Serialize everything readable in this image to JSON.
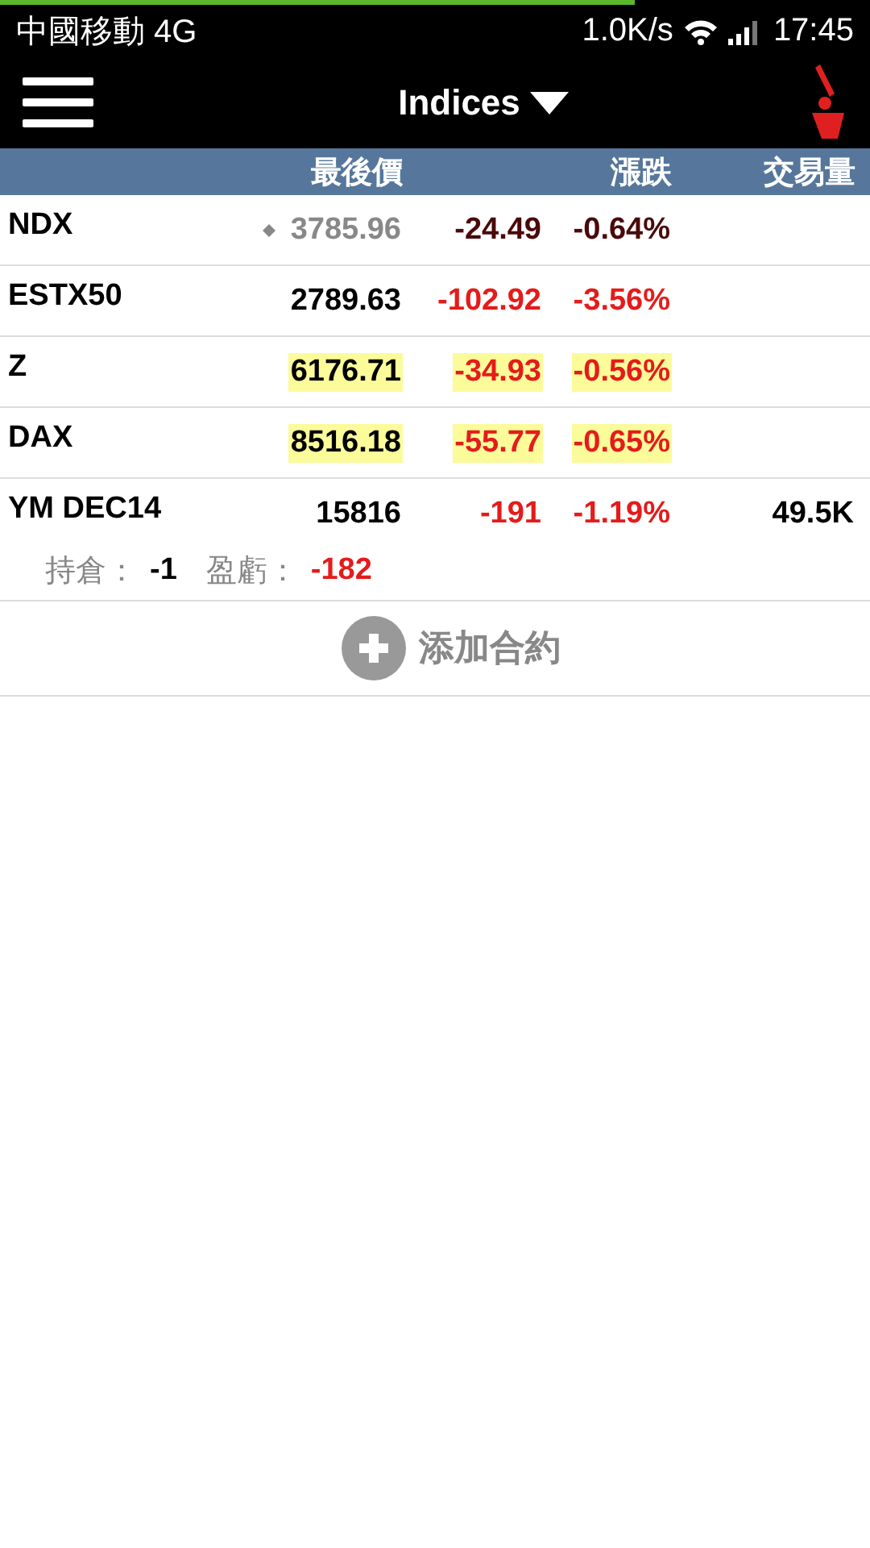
{
  "loading_bar": {
    "level": 0.73
  },
  "status_bar": {
    "carrier": "中國移動 4G",
    "speed": "1.0K/s",
    "time": "17:45"
  },
  "app_bar": {
    "title": "Indices"
  },
  "table": {
    "columns": [
      "最後價",
      "漲跌",
      "交易量"
    ],
    "rows": [
      {
        "name": "NDX",
        "last": "3785.96",
        "change": "-24.49",
        "pct": "-0.64%",
        "stale": true,
        "highlighted": false
      },
      {
        "name": "ESTX50",
        "last": "2789.63",
        "change": "-102.92",
        "pct": "-3.56%",
        "stale": false,
        "highlighted": false
      },
      {
        "name": "Z",
        "last": "6176.71",
        "change": "-34.93",
        "pct": "-0.56%",
        "stale": false,
        "highlighted": true
      },
      {
        "name": "DAX",
        "last": "8516.18",
        "change": "-55.77",
        "pct": "-0.65%",
        "stale": false,
        "highlighted": true
      },
      {
        "name": "YM DEC14",
        "last": "15816",
        "change": "-191",
        "pct": "-1.19%",
        "volume": "49.5K",
        "stale": false,
        "highlighted": false,
        "position": {
          "label": "持倉：",
          "value": "-1",
          "pnl_label": "盈虧：",
          "pnl": "-182"
        }
      }
    ]
  },
  "add_button": {
    "label": "添加合約"
  }
}
